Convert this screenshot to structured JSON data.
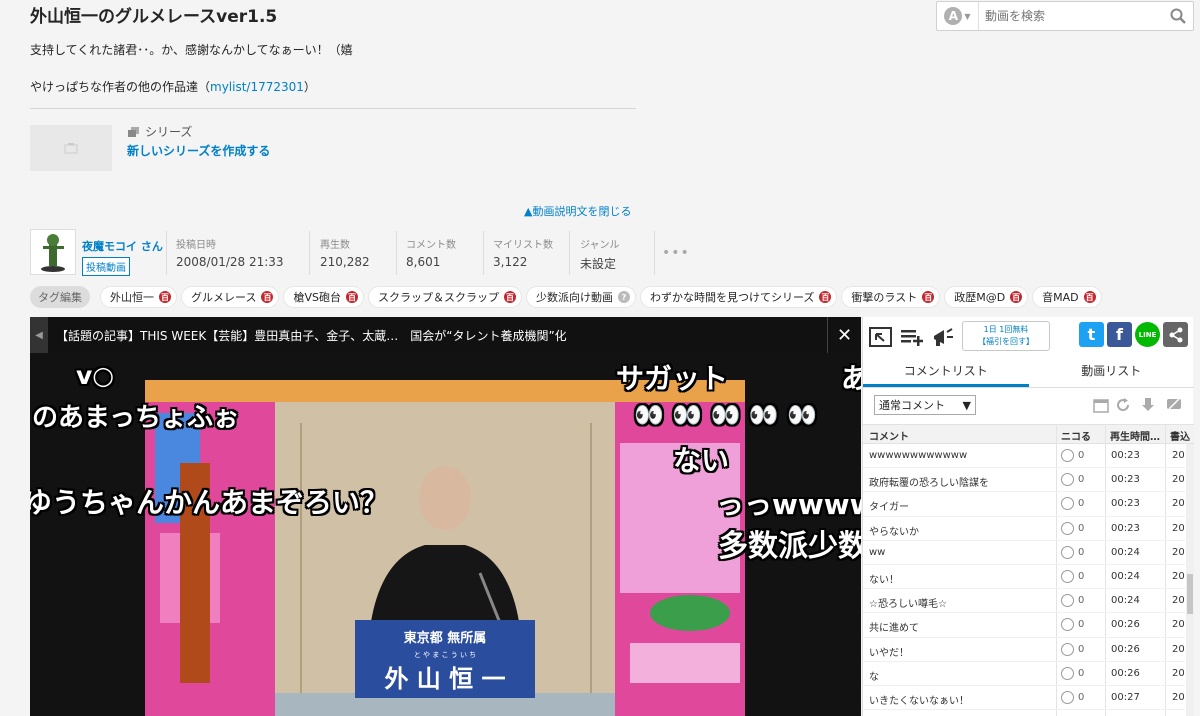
{
  "video": {
    "title": "外山恒一のグルメレースver1.5",
    "desc_line1": "支持してくれた諸君･･。か、感謝なんかしてなぁーい！（嬉",
    "desc_line2_prefix": "やけっぱちな作者の他の作品達（",
    "desc_line2_link": "mylist/1772301",
    "desc_line2_suffix": "）"
  },
  "search": {
    "placeholder": "動画を検索",
    "selector_letter": "A"
  },
  "series": {
    "label": "シリーズ",
    "create_link": "新しいシリーズを作成する"
  },
  "close_description": "▲動画説明文を閉じる",
  "uploader": {
    "name": "夜魔モコイ さん",
    "badge": "投稿動画"
  },
  "stats": {
    "posted_label": "投稿日時",
    "posted_value": "2008/01/28 21:33",
    "views_label": "再生数",
    "views_value": "210,282",
    "comments_label": "コメント数",
    "comments_value": "8,601",
    "mylist_label": "マイリスト数",
    "mylist_value": "3,122",
    "genre_label": "ジャンル",
    "genre_value": "未設定",
    "more": "•••"
  },
  "tags": {
    "edit_label": "タグ編集",
    "items": [
      {
        "label": "外山恒一",
        "locked": true
      },
      {
        "label": "グルメレース",
        "locked": true
      },
      {
        "label": "槍VS砲台",
        "locked": true
      },
      {
        "label": "スクラップ＆スクラップ",
        "locked": true
      },
      {
        "label": "少数派向け動画",
        "locked": false
      },
      {
        "label": "わずかな時間を見つけてシリーズ",
        "locked": true
      },
      {
        "label": "衝撃のラスト",
        "locked": true
      },
      {
        "label": "政歴M@D",
        "locked": true
      },
      {
        "label": "音MAD",
        "locked": true
      }
    ]
  },
  "player": {
    "news": "【話題の記事】THIS WEEK【芸能】豊田真由子、金子、太蔵…　国会が“タレント養成機関”化",
    "close": "✕",
    "overlay_comments": [
      "v○",
      "のあまっちょふぉ",
      "ゆうちゃんかんあまぞろい？",
      "サガット",
      "👀 👀 👀 👀 👀",
      "ない",
      "っっwwwww",
      "多数派少数",
      "あ"
    ],
    "sign_top": "東京都 無所属",
    "sign_ruby": "と や ま こ う い ち",
    "sign_name": "外 山 恒 一"
  },
  "panel": {
    "free_line1": "1日 1回無料",
    "free_line2": "【福引を回す】",
    "share_twitter": "t",
    "share_facebook": "f",
    "share_line": "LINE",
    "tab_comments": "コメントリスト",
    "tab_videos": "動画リスト",
    "comment_type": "通常コメント",
    "col_comment": "コメント",
    "col_nicoru": "ニコる",
    "col_time": "再生時間…",
    "col_written": "書込",
    "rows": [
      {
        "text": "wwwwwwwwwwww",
        "nicoru": "0",
        "time": "00:23",
        "written": "20"
      },
      {
        "text": "政府転覆の恐ろしい陰謀を",
        "nicoru": "0",
        "time": "00:23",
        "written": "20"
      },
      {
        "text": "タイガー",
        "nicoru": "0",
        "time": "00:23",
        "written": "20"
      },
      {
        "text": "やらないか",
        "nicoru": "0",
        "time": "00:23",
        "written": "20"
      },
      {
        "text": "ww",
        "nicoru": "0",
        "time": "00:24",
        "written": "20"
      },
      {
        "text": "ない！",
        "nicoru": "0",
        "time": "00:24",
        "written": "20"
      },
      {
        "text": "☆恐ろしい噂毛☆",
        "nicoru": "0",
        "time": "00:24",
        "written": "20"
      },
      {
        "text": "共に進めて",
        "nicoru": "0",
        "time": "00:26",
        "written": "20"
      },
      {
        "text": "いやだ！",
        "nicoru": "0",
        "time": "00:26",
        "written": "20"
      },
      {
        "text": "な",
        "nicoru": "0",
        "time": "00:26",
        "written": "20"
      },
      {
        "text": "いきたくないなぁい！",
        "nicoru": "0",
        "time": "00:27",
        "written": "20"
      }
    ]
  },
  "colors": {
    "accent": "#0080c9",
    "tag_lock": "#c2272d",
    "twitter": "#1da1f2",
    "facebook": "#3b5998",
    "line": "#00b900"
  }
}
